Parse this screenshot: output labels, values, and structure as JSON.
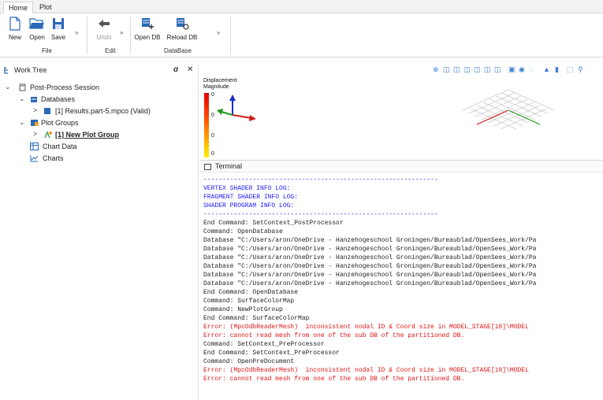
{
  "tabs": [
    {
      "label": "Home"
    },
    {
      "label": "Plot"
    }
  ],
  "ribbon": {
    "file": {
      "new": "New",
      "open": "Open",
      "save": "Save",
      "group": "File"
    },
    "edit": {
      "undo": "Undo",
      "group": "Edit"
    },
    "database": {
      "open_db": "Open DB",
      "reload_db": "Reload DB",
      "group": "DataBase"
    },
    "overflow": "»",
    "colors": {
      "accent": "#2a68b8"
    }
  },
  "worktree": {
    "title": "Work Tree",
    "pin": "ɑ",
    "close": "✕",
    "items": [
      {
        "label": "Post-Process Session",
        "expander": "⌄"
      },
      {
        "label": "Databases",
        "expander": "⌄"
      },
      {
        "label": "[1] Results.part-5.mpco (Valid)",
        "expander": ">"
      },
      {
        "label": "Plot Groups",
        "expander": "⌄"
      },
      {
        "label": "[1] New Plot Group",
        "expander": ">"
      },
      {
        "label": "Chart Data"
      },
      {
        "label": "Charts"
      }
    ]
  },
  "viewport": {
    "legend_title": "Displacement\nMagnitude",
    "legend_values": [
      "0",
      "0",
      "0",
      "0"
    ],
    "legend_colors": [
      "#e00000",
      "#ff8800",
      "#ffee00"
    ]
  },
  "terminal": {
    "title": "Terminal",
    "lines": [
      {
        "text": "--------------------------------------------------------------",
        "kind": "blue"
      },
      {
        "text": "VERTEX SHADER INFO LOG:",
        "kind": "blue"
      },
      {
        "text": "FRAGMENT SHADER INFO LOG:",
        "kind": "blue"
      },
      {
        "text": "SHADER PROGRAM INFO LOG:",
        "kind": "blue"
      },
      {
        "text": "--------------------------------------------------------------",
        "kind": "blue"
      },
      {
        "text": "End Command: SetContext_PostProcessor",
        "kind": "normal"
      },
      {
        "text": "Command: OpenDatabase",
        "kind": "normal"
      },
      {
        "text": "Database \"C:/Users/aron/OneDrive - Hanzehogeschool Groningen/Bureaublad/OpenSees_Work/Pa",
        "kind": "normal"
      },
      {
        "text": "Database \"C:/Users/aron/OneDrive - Hanzehogeschool Groningen/Bureaublad/OpenSees_Work/Pa",
        "kind": "normal"
      },
      {
        "text": "Database \"C:/Users/aron/OneDrive - Hanzehogeschool Groningen/Bureaublad/OpenSees_Work/Pa",
        "kind": "normal"
      },
      {
        "text": "Database \"C:/Users/aron/OneDrive - Hanzehogeschool Groningen/Bureaublad/OpenSees_Work/Pa",
        "kind": "normal"
      },
      {
        "text": "Database \"C:/Users/aron/OneDrive - Hanzehogeschool Groningen/Bureaublad/OpenSees_Work/Pa",
        "kind": "normal"
      },
      {
        "text": "Database \"C:/Users/aron/OneDrive - Hanzehogeschool Groningen/Bureaublad/OpenSees_Work/Pa",
        "kind": "normal"
      },
      {
        "text": "End Command: OpenDatabase",
        "kind": "normal"
      },
      {
        "text": "Command: SurfaceColorMap",
        "kind": "normal"
      },
      {
        "text": "Command: NewPlotGroup",
        "kind": "normal"
      },
      {
        "text": "End Command: SurfaceColorMap",
        "kind": "normal"
      },
      {
        "text": "Error: (MpcOdbReaderMesh)  inconsistent nodal ID & Coord size in MODEL_STAGE[10]\\MODEL",
        "kind": "red"
      },
      {
        "text": "Error: cannot read mesh from one of the sub DB of the partitioned DB.",
        "kind": "red"
      },
      {
        "text": "Command: SetContext_PreProcessor",
        "kind": "normal"
      },
      {
        "text": "End Command: SetContext_PreProcessor",
        "kind": "normal"
      },
      {
        "text": "Command: OpenPreDocument",
        "kind": "normal"
      },
      {
        "text": "Error: (MpcOdbReaderMesh)  inconsistent nodal ID & Coord size in MODEL_STAGE[10]\\MODEL",
        "kind": "red"
      },
      {
        "text": "Error: cannot read mesh from one of the sub DB of the partitioned DB.",
        "kind": "red"
      }
    ]
  }
}
